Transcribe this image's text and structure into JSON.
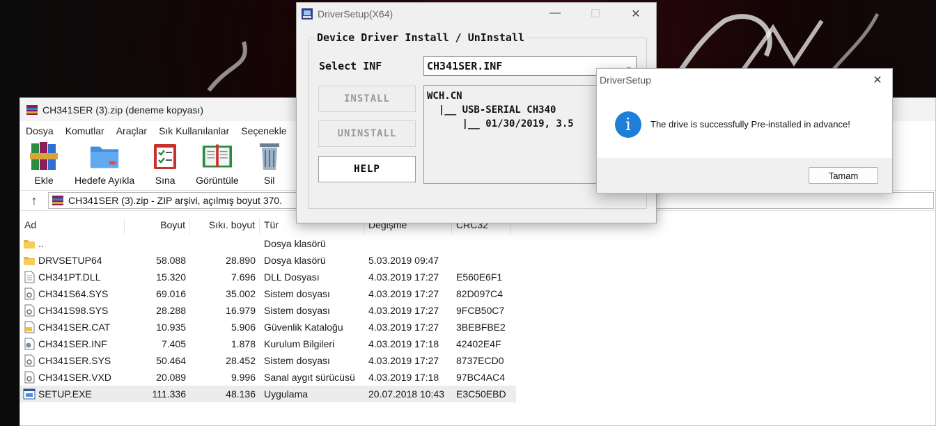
{
  "winrar": {
    "title": "CH341SER (3).zip (deneme kopyası)",
    "menu": [
      "Dosya",
      "Komutlar",
      "Araçlar",
      "Sık Kullanılanlar",
      "Seçenekle"
    ],
    "toolbar": [
      "Ekle",
      "Hedefe Ayıkla",
      "Sına",
      "Görüntüle",
      "Sil"
    ],
    "path": "CH341SER (3).zip - ZIP arşivi, açılmış boyut 370.",
    "columns": {
      "name": "Ad",
      "size": "Boyut",
      "packed": "Sıkı. boyut",
      "type": "Tür",
      "modified": "Değişme",
      "crc": "CRC32"
    },
    "files": [
      {
        "name": "..",
        "size": "",
        "packed": "",
        "type": "Dosya klasörü",
        "modified": "",
        "crc": "",
        "icon": "folder-icon"
      },
      {
        "name": "DRVSETUP64",
        "size": "58.088",
        "packed": "28.890",
        "type": "Dosya klasörü",
        "modified": "5.03.2019 09:47",
        "crc": "",
        "icon": "folder-icon"
      },
      {
        "name": "CH341PT.DLL",
        "size": "15.320",
        "packed": "7.696",
        "type": "DLL Dosyası",
        "modified": "4.03.2019 17:27",
        "crc": "E560E6F1",
        "icon": "file-icon"
      },
      {
        "name": "CH341S64.SYS",
        "size": "69.016",
        "packed": "35.002",
        "type": "Sistem dosyası",
        "modified": "4.03.2019 17:27",
        "crc": "82D097C4",
        "icon": "gear-file-icon"
      },
      {
        "name": "CH341S98.SYS",
        "size": "28.288",
        "packed": "16.979",
        "type": "Sistem dosyası",
        "modified": "4.03.2019 17:27",
        "crc": "9FCB50C7",
        "icon": "gear-file-icon"
      },
      {
        "name": "CH341SER.CAT",
        "size": "10.935",
        "packed": "5.906",
        "type": "Güvenlik Kataloğu",
        "modified": "4.03.2019 17:27",
        "crc": "3BEBFBE2",
        "icon": "catalog-icon"
      },
      {
        "name": "CH341SER.INF",
        "size": "7.405",
        "packed": "1.878",
        "type": "Kurulum Bilgileri",
        "modified": "4.03.2019 17:18",
        "crc": "42402E4F",
        "icon": "setup-info-icon"
      },
      {
        "name": "CH341SER.SYS",
        "size": "50.464",
        "packed": "28.452",
        "type": "Sistem dosyası",
        "modified": "4.03.2019 17:27",
        "crc": "8737ECD0",
        "icon": "gear-file-icon"
      },
      {
        "name": "CH341SER.VXD",
        "size": "20.089",
        "packed": "9.996",
        "type": "Sanal aygıt sürücüsü",
        "modified": "4.03.2019 17:18",
        "crc": "97BC4AC4",
        "icon": "gear-file-icon"
      },
      {
        "name": "SETUP.EXE",
        "size": "111.336",
        "packed": "48.136",
        "type": "Uygulama",
        "modified": "20.07.2018 10:43",
        "crc": "E3C50EBD",
        "icon": "exe-icon",
        "selected": true
      }
    ]
  },
  "driver_setup": {
    "title": "DriverSetup(X64)",
    "group_title": "Device Driver Install / UnInstall",
    "select_label": "Select INF",
    "select_value": "CH341SER.INF",
    "install_label": "INSTALL",
    "uninstall_label": "UNINSTALL",
    "help_label": "HELP",
    "info_lines": [
      "WCH.CN",
      "  |__ USB-SERIAL CH340",
      "      |__ 01/30/2019, 3.5"
    ]
  },
  "message": {
    "title": "DriverSetup",
    "text": "The drive is successfully Pre-installed in advance!",
    "ok_label": "Tamam"
  }
}
